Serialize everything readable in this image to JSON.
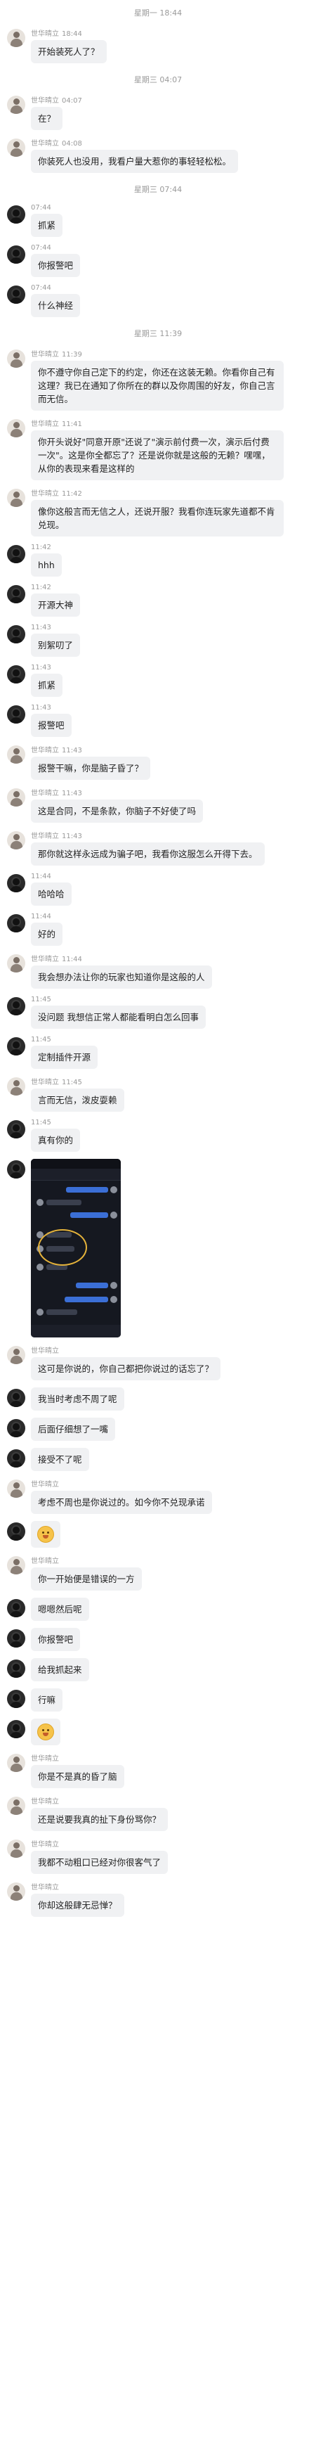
{
  "chat": {
    "items": [
      {
        "kind": "stamp",
        "text": "星期一 18:44"
      },
      {
        "kind": "msg",
        "avatar": "a",
        "sender": "世华晴立",
        "time": "18:44",
        "text": "开始装死人了？"
      },
      {
        "kind": "stamp",
        "text": "星期三 04:07"
      },
      {
        "kind": "msg",
        "avatar": "a",
        "sender": "世华晴立",
        "time": "04:07",
        "text": "在？"
      },
      {
        "kind": "msg",
        "avatar": "a",
        "sender": "世华晴立",
        "time": "04:08",
        "text": "你装死人也没用，我看户量大惹你的事轻轻松松。"
      },
      {
        "kind": "stamp",
        "text": "星期三 07:44"
      },
      {
        "kind": "msg",
        "avatar": "b",
        "sender": "",
        "time": "07:44",
        "text": "抓紧"
      },
      {
        "kind": "msg",
        "avatar": "b",
        "sender": "",
        "time": "07:44",
        "text": "你报警吧"
      },
      {
        "kind": "msg",
        "avatar": "b",
        "sender": "",
        "time": "07:44",
        "text": "什么神经"
      },
      {
        "kind": "stamp",
        "text": "星期三 11:39"
      },
      {
        "kind": "msg",
        "avatar": "a",
        "sender": "世华晴立",
        "time": "11:39",
        "text": "你不遵守你自己定下的约定，你还在这装无赖。你看你自己有这理？我已在通知了你所在的群以及你周围的好友，你自己言而无信。"
      },
      {
        "kind": "msg",
        "avatar": "a",
        "sender": "世华晴立",
        "time": "11:41",
        "text": "你开头说好\"同意开原\"还说了\"演示前付费一次，演示后付费一次\"。这是你全都忘了？还是说你就是这般的无赖？嘿嘿，从你的表现来看是这样的"
      },
      {
        "kind": "msg",
        "avatar": "a",
        "sender": "世华晴立",
        "time": "11:42",
        "text": "像你这般言而无信之人，还说开服？我看你连玩家先道都不肯兑现。"
      },
      {
        "kind": "msg",
        "avatar": "b",
        "sender": "",
        "time": "11:42",
        "text": "hhh"
      },
      {
        "kind": "msg",
        "avatar": "b",
        "sender": "",
        "time": "11:42",
        "text": "开源大神"
      },
      {
        "kind": "msg",
        "avatar": "b",
        "sender": "",
        "time": "11:43",
        "text": "别絮叨了"
      },
      {
        "kind": "msg",
        "avatar": "b",
        "sender": "",
        "time": "11:43",
        "text": "抓紧"
      },
      {
        "kind": "msg",
        "avatar": "b",
        "sender": "",
        "time": "11:43",
        "text": "报警吧"
      },
      {
        "kind": "msg",
        "avatar": "a",
        "sender": "世华晴立",
        "time": "11:43",
        "text": "报警干嘛，你是脑子昏了？"
      },
      {
        "kind": "msg",
        "avatar": "a",
        "sender": "世华晴立",
        "time": "11:43",
        "text": "这是合同，不是条款，你脑子不好使了吗"
      },
      {
        "kind": "msg",
        "avatar": "a",
        "sender": "世华晴立",
        "time": "11:43",
        "text": "那你就这样永远成为骗子吧，我看你这服怎么开得下去。"
      },
      {
        "kind": "msg",
        "avatar": "b",
        "sender": "",
        "time": "11:44",
        "text": "哈哈哈"
      },
      {
        "kind": "msg",
        "avatar": "b",
        "sender": "",
        "time": "11:44",
        "text": "好的"
      },
      {
        "kind": "msg",
        "avatar": "a",
        "sender": "世华晴立",
        "time": "11:44",
        "text": "我会想办法让你的玩家也知道你是这般的人"
      },
      {
        "kind": "msg",
        "avatar": "b",
        "sender": "",
        "time": "11:45",
        "text": "没问题 我想信正常人都能看明白怎么回事"
      },
      {
        "kind": "msg",
        "avatar": "b",
        "sender": "",
        "time": "11:45",
        "text": "定制插件开源"
      },
      {
        "kind": "msg",
        "avatar": "a",
        "sender": "世华晴立",
        "time": "11:45",
        "text": "言而无信，泼皮耍赖"
      },
      {
        "kind": "msg",
        "avatar": "b",
        "sender": "",
        "time": "11:45",
        "text": "真有你的"
      },
      {
        "kind": "image",
        "avatar": "b",
        "sender": "",
        "time": ""
      },
      {
        "kind": "msg",
        "avatar": "a",
        "sender": "世华晴立",
        "time": "",
        "text": "这可是你说的，你自己都把你说过的话忘了？"
      },
      {
        "kind": "msg",
        "avatar": "b",
        "sender": "",
        "time": "",
        "text": "我当时考虑不周了呢"
      },
      {
        "kind": "msg",
        "avatar": "b",
        "sender": "",
        "time": "",
        "text": "后面仔细想了一嘴"
      },
      {
        "kind": "msg",
        "avatar": "b",
        "sender": "",
        "time": "",
        "text": "接受不了呢"
      },
      {
        "kind": "msg",
        "avatar": "a",
        "sender": "世华晴立",
        "time": "",
        "text": "考虑不周也是你说过的。如今你不兑现承诺"
      },
      {
        "kind": "emoji",
        "avatar": "b",
        "sender": "",
        "time": "",
        "icon": "grin-emoji-icon"
      },
      {
        "kind": "msg",
        "avatar": "a",
        "sender": "世华晴立",
        "time": "",
        "text": "你一开始便是错误的一方"
      },
      {
        "kind": "msg",
        "avatar": "b",
        "sender": "",
        "time": "",
        "text": "嗯嗯然后呢"
      },
      {
        "kind": "msg",
        "avatar": "b",
        "sender": "",
        "time": "",
        "text": "你报警吧"
      },
      {
        "kind": "msg",
        "avatar": "b",
        "sender": "",
        "time": "",
        "text": "给我抓起来"
      },
      {
        "kind": "msg",
        "avatar": "b",
        "sender": "",
        "time": "",
        "text": "行嘛"
      },
      {
        "kind": "emoji",
        "avatar": "b",
        "sender": "",
        "time": "",
        "icon": "grin-emoji-icon"
      },
      {
        "kind": "msg",
        "avatar": "a",
        "sender": "世华晴立",
        "time": "",
        "text": "你是不是真的昏了脑"
      },
      {
        "kind": "msg",
        "avatar": "a",
        "sender": "世华晴立",
        "time": "",
        "text": "还是说要我真的扯下身份骂你？"
      },
      {
        "kind": "msg",
        "avatar": "a",
        "sender": "世华晴立",
        "time": "",
        "text": "我都不动粗口已经对你很客气了"
      },
      {
        "kind": "msg",
        "avatar": "a",
        "sender": "世华晴立",
        "time": "",
        "text": "你却这般肆无忌惮？"
      }
    ]
  }
}
